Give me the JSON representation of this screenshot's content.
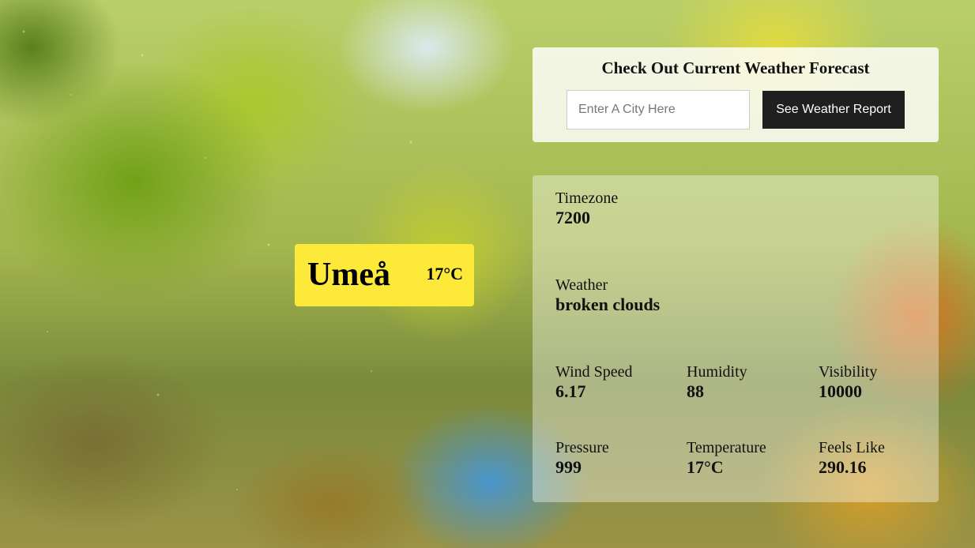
{
  "search": {
    "title": "Check Out Current Weather Forecast",
    "placeholder": "Enter A City Here",
    "value": "",
    "button_label": "See Weather Report"
  },
  "city_card": {
    "name": "Umeå",
    "temperature": "17°C"
  },
  "stats": {
    "timezone": {
      "label": "Timezone",
      "value": "7200"
    },
    "weather": {
      "label": "Weather",
      "value": "broken clouds"
    },
    "wind_speed": {
      "label": "Wind Speed",
      "value": "6.17"
    },
    "humidity": {
      "label": "Humidity",
      "value": "88"
    },
    "visibility": {
      "label": "Visibility",
      "value": "10000"
    },
    "pressure": {
      "label": "Pressure",
      "value": "999"
    },
    "temperature": {
      "label": "Temperature",
      "value": "17°C"
    },
    "feels_like": {
      "label": "Feels Like",
      "value": "290.16"
    }
  },
  "colors": {
    "city_card_bg": "#fde93a",
    "button_bg": "#1f1f1f"
  }
}
